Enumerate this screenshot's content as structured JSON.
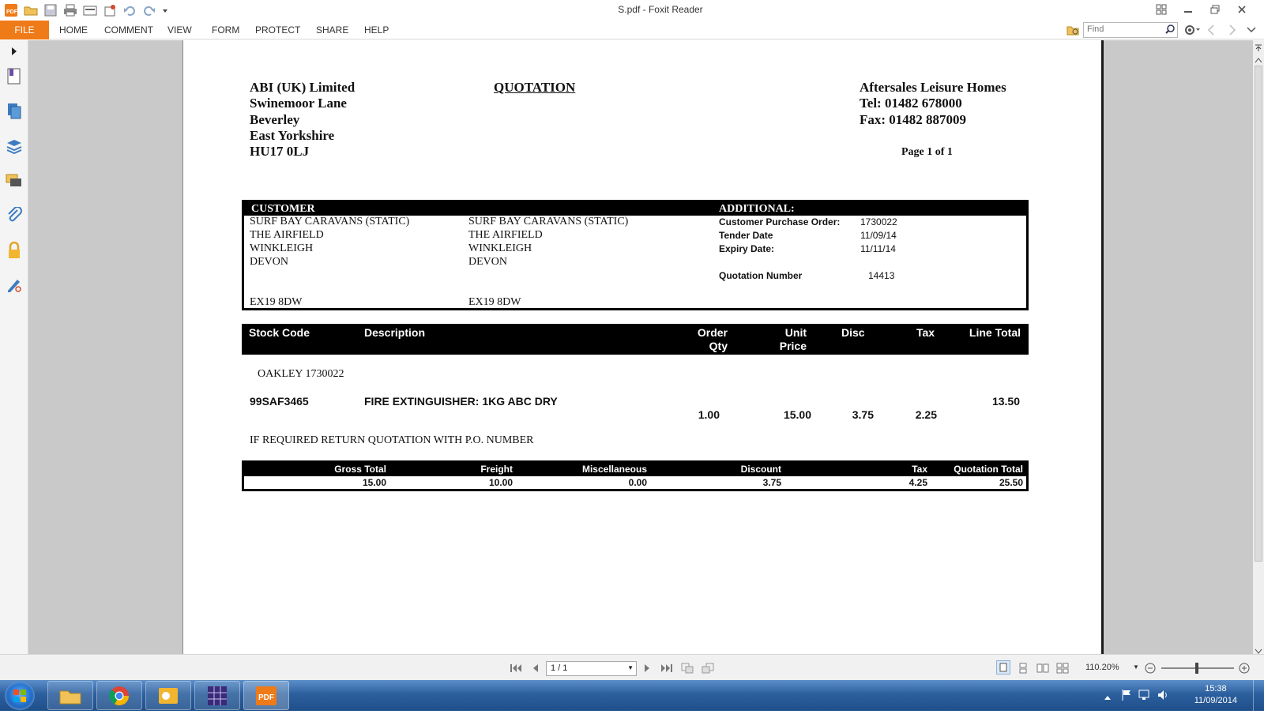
{
  "app": {
    "window_title": "S.pdf - Foxit Reader"
  },
  "ribbon": {
    "tabs": [
      "FILE",
      "HOME",
      "COMMENT",
      "VIEW",
      "FORM",
      "PROTECT",
      "SHARE",
      "HELP"
    ],
    "find_placeholder": "Find"
  },
  "document": {
    "company_lines": [
      "ABI (UK) Limited",
      "Swinemoor Lane",
      "Beverley",
      "East Yorkshire",
      "HU17 0LJ"
    ],
    "title": "QUOTATION",
    "dealer_lines": [
      "Aftersales Leisure Homes",
      "Tel: 01482 678000",
      "Fax: 01482 887009"
    ],
    "page_of": "Page 1 of 1",
    "customer": {
      "heading": "CUSTOMER",
      "invoice_lines": [
        "SURF BAY CARAVANS (STATIC)",
        "THE AIRFIELD",
        "WINKLEIGH",
        "DEVON"
      ],
      "delivery_lines": [
        "SURF BAY CARAVANS (STATIC)",
        "THE AIRFIELD",
        "WINKLEIGH",
        "DEVON"
      ],
      "invoice_postcode": "EX19 8DW",
      "delivery_postcode": "EX19 8DW"
    },
    "additional": {
      "heading": "ADDITIONAL:",
      "po_label": "Customer Purchase Order:",
      "po_value": "1730022",
      "tender_label": "Tender Date",
      "tender_value": "11/09/14",
      "expiry_label": "Expiry Date:",
      "expiry_value": "11/11/14",
      "quote_no_label": "Quotation Number",
      "quote_no_value": "14413"
    },
    "items_header": {
      "stock_code": "Stock Code",
      "description": "Description",
      "order_qty_1": "Order",
      "order_qty_2": "Qty",
      "unit_price_1": "Unit",
      "unit_price_2": "Price",
      "disc": "Disc",
      "tax": "Tax",
      "line_total": "Line Total"
    },
    "reference": "OAKLEY 1730022",
    "item": {
      "stock_code": "99SAF3465",
      "description": "FIRE EXTINGUISHER: 1KG ABC DRY",
      "line_total": "13.50",
      "order_qty": "1.00",
      "unit_price": "15.00",
      "disc": "3.75",
      "tax": "2.25"
    },
    "note": "IF REQUIRED RETURN QUOTATION WITH P.O. NUMBER",
    "totals": {
      "gross_label": "Gross Total",
      "gross_value": "15.00",
      "freight_label": "Freight",
      "freight_value": "10.00",
      "misc_label": "Miscellaneous",
      "misc_value": "0.00",
      "discount_label": "Discount",
      "discount_value": "3.75",
      "tax_label": "Tax",
      "tax_value": "4.25",
      "quote_total_label": "Quotation Total",
      "quote_total_value": "25.50"
    }
  },
  "statusbar": {
    "page_value": "1 / 1",
    "zoom": "110.20%"
  },
  "taskbar": {
    "time": "15:38",
    "date": "11/09/2014"
  },
  "colors": {
    "accent_orange": "#ef7a18",
    "taskbar_blue": "#2c5f9e"
  }
}
